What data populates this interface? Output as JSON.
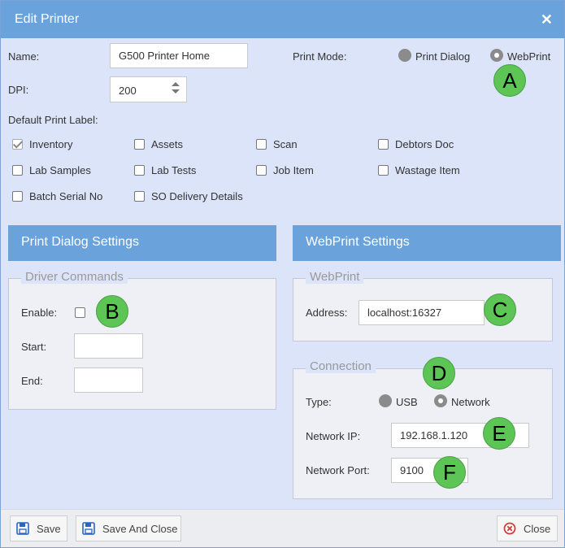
{
  "window": {
    "title": "Edit Printer"
  },
  "form": {
    "name_label": "Name:",
    "name_value": "G500 Printer Home",
    "dpi_label": "DPI:",
    "dpi_value": "200",
    "print_mode_label": "Print Mode:",
    "print_mode_options": [
      "Print Dialog",
      "WebPrint"
    ],
    "print_mode_selected": "WebPrint",
    "default_label_heading": "Default Print Label:",
    "labels": [
      {
        "label": "Inventory",
        "checked": true
      },
      {
        "label": "Assets",
        "checked": false
      },
      {
        "label": "Scan",
        "checked": false
      },
      {
        "label": "Debtors Doc",
        "checked": false
      },
      {
        "label": "Lab Samples",
        "checked": false
      },
      {
        "label": "Lab Tests",
        "checked": false
      },
      {
        "label": "Job Item",
        "checked": false
      },
      {
        "label": "Wastage Item",
        "checked": false
      },
      {
        "label": "Batch Serial No",
        "checked": false
      },
      {
        "label": "SO Delivery Details",
        "checked": false
      }
    ]
  },
  "print_dialog": {
    "heading": "Print Dialog Settings",
    "group_title": "Driver Commands",
    "enable_label": "Enable:",
    "start_label": "Start:",
    "start_value": "",
    "end_label": "End:",
    "end_value": ""
  },
  "webprint": {
    "heading": "WebPrint Settings",
    "group_title": "WebPrint",
    "address_label": "Address:",
    "address_value": "localhost:16327",
    "connection_title": "Connection",
    "type_label": "Type:",
    "type_options": [
      "USB",
      "Network"
    ],
    "type_selected": "Network",
    "network_ip_label": "Network IP:",
    "network_ip_value": "192.168.1.120",
    "network_port_label": "Network Port:",
    "network_port_value": "9100"
  },
  "annotations": [
    "A",
    "B",
    "C",
    "D",
    "E",
    "F"
  ],
  "footer": {
    "save_label": "Save",
    "save_close_label": "Save And Close",
    "close_label": "Close"
  },
  "colors": {
    "titlebar": "#6aa2dc",
    "body": "#dce4fa",
    "badge": "#5dc456"
  },
  "icons": {
    "close": "close-x-icon",
    "save": "floppy-disk-icon",
    "cancel": "circle-x-icon"
  }
}
